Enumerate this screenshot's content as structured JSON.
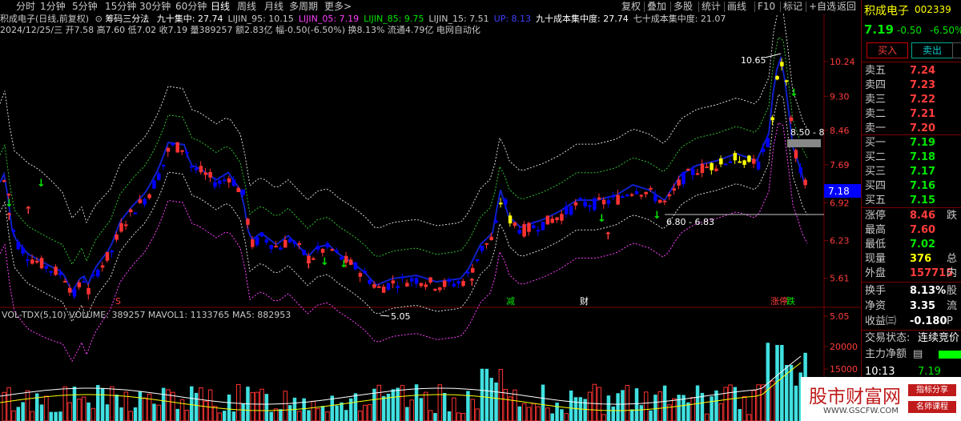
{
  "toolbar": {
    "periods": [
      "分时",
      "1分钟",
      "5分钟",
      "15分钟",
      "30分钟",
      "60分钟",
      "日线",
      "周线",
      "月线",
      "多周期",
      "更多>"
    ],
    "selected": "日线",
    "right": [
      "复权",
      "叠加",
      "多股",
      "统计",
      "画线",
      "F10",
      "标记",
      "+自选",
      "返回"
    ]
  },
  "header": {
    "title": "积成电子(日线,前复权)",
    "indicator": "筹码三分法",
    "items": [
      {
        "text": "九十集中: 27.74",
        "color": "#ffffff"
      },
      {
        "text": "LIJIN_95: 10.15",
        "color": "#c8c8c8"
      },
      {
        "text": "LIJIN_05: 7.19",
        "color": "#ff40ff"
      },
      {
        "text": "LIJIN_85: 9.75",
        "color": "#00e600"
      },
      {
        "text": "LIJIN_15: 7.51",
        "color": "#c8c8c8"
      },
      {
        "text": "UP: 8.13",
        "color": "#4040ff"
      },
      {
        "text": "九十成本集中度: 27.74",
        "color": "#ffffff"
      },
      {
        "text": "七十成本集中度: 21.07",
        "color": "#c8c8c8"
      }
    ],
    "line2": "2024/12/25/三 开7.58 高7.60 低7.02 收7.19 量389257 额2.83亿 幅-0.50(-6.50%) 换8.13% 流通4.79亿 电网自动化"
  },
  "price_axis": [
    "10.24",
    "9.30",
    "8.46",
    "7.69",
    "6.92",
    "6.23",
    "5.61",
    "5.05"
  ],
  "annotations": {
    "high": "10.65",
    "low": "5.05",
    "mid": "6.80 - 6.83",
    "range": "8.50 - 8",
    "current": "7.18"
  },
  "markers": [
    "S",
    "减",
    "财",
    "涨停",
    "跌"
  ],
  "volume": {
    "label": "VOL-TDX(5,10) VOLUME: 389257 MAVOL1: 1133765 MA5: 882953",
    "axis": [
      "20000",
      "15000",
      "10000"
    ]
  },
  "panel": {
    "name": "积成电子",
    "code": "002339",
    "price": "7.19",
    "change": "-0.50",
    "pct": "-6.50%",
    "buy_label": "买入",
    "sell_label": "卖出",
    "asks": [
      {
        "label": "卖五",
        "price": "7.24"
      },
      {
        "label": "卖四",
        "price": "7.23"
      },
      {
        "label": "卖三",
        "price": "7.22"
      },
      {
        "label": "卖二",
        "price": "7.21"
      },
      {
        "label": "卖一",
        "price": "7.20"
      }
    ],
    "bids": [
      {
        "label": "买一",
        "price": "7.19"
      },
      {
        "label": "买二",
        "price": "7.18"
      },
      {
        "label": "买三",
        "price": "7.17"
      },
      {
        "label": "买四",
        "price": "7.16"
      },
      {
        "label": "买五",
        "price": "7.15"
      }
    ],
    "stats": [
      {
        "label": "涨停",
        "value": "8.46",
        "suffix": "跌",
        "color": "#ff3c3c"
      },
      {
        "label": "最高",
        "value": "7.60",
        "suffix": "",
        "color": "#ff3c3c"
      },
      {
        "label": "最低",
        "value": "7.02",
        "suffix": "",
        "color": "#00e600"
      },
      {
        "label": "现量",
        "value": "376",
        "suffix": "总",
        "color": "#ffff00"
      },
      {
        "label": "外盘",
        "value": "157715",
        "suffix": "内",
        "color": "#ff3c3c"
      }
    ],
    "stats2": [
      {
        "label": "换手",
        "value": "8.13%",
        "suffix": "股"
      },
      {
        "label": "净资",
        "value": "3.35",
        "suffix": "流"
      },
      {
        "label": "收益㈢",
        "value": "-0.180",
        "suffix": "P"
      }
    ],
    "state_label": "交易状态:",
    "state": "连续竞价",
    "flow_label": "主力净额",
    "time": "10:13",
    "time_price": "7.19"
  },
  "watermark": {
    "cn": "股市财富网",
    "url": "WWW.GSCFW.COM",
    "tag1": "指标分享",
    "tag2": "名师课程"
  },
  "colors": {
    "up": "#ff3232",
    "down": "#0000ff",
    "yellow": "#ffff00",
    "ma": "#1020c8",
    "bg": "#000000"
  }
}
